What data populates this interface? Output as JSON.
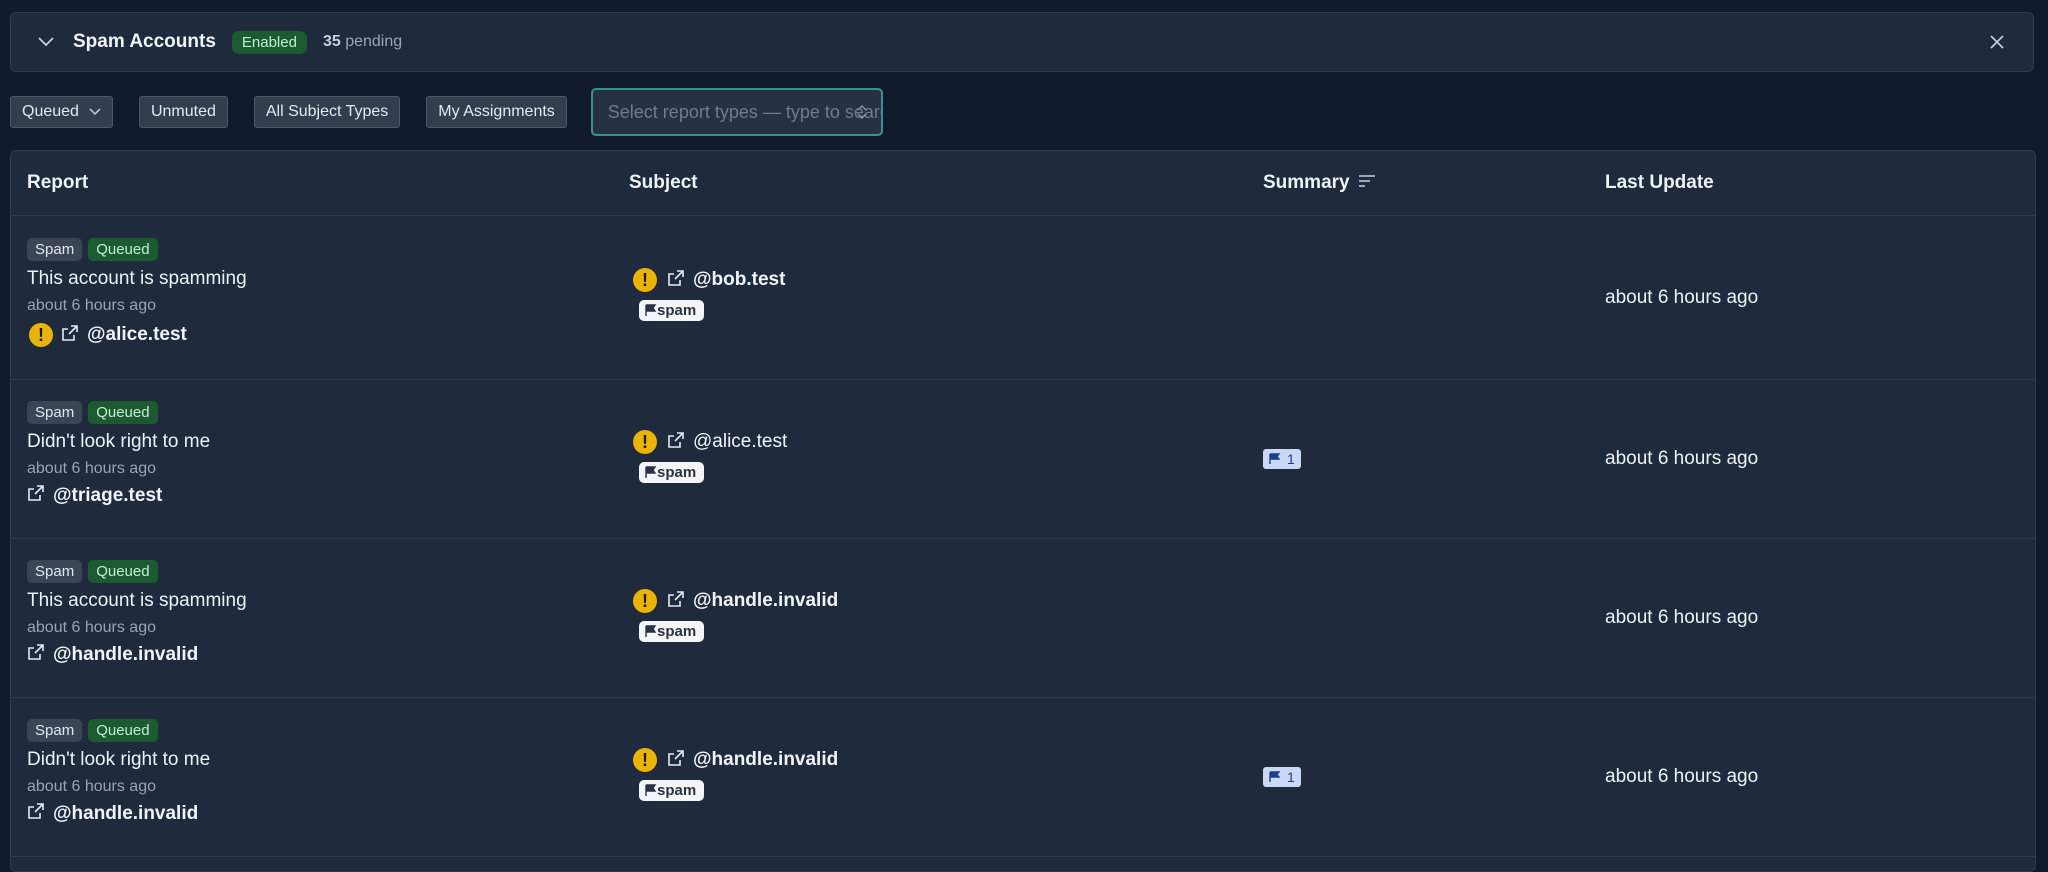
{
  "queue": {
    "name": "Spam Accounts",
    "status": "Enabled",
    "pending_count": "35",
    "pending_label": "pending"
  },
  "filters": {
    "queued": "Queued",
    "unmuted": "Unmuted",
    "subject_types": "All Subject Types",
    "assignments": "My Assignments",
    "report_type_placeholder": "Select report types — type to search"
  },
  "table": {
    "headers": {
      "report": "Report",
      "subject": "Subject",
      "summary": "Summary",
      "last_update": "Last Update"
    },
    "rows": [
      {
        "report_tag": "Spam",
        "status_tag": "Queued",
        "reason": "This account is spamming",
        "reported_ago": "about 6 hours ago",
        "reporter": "@alice.test",
        "reporter_warning": "!",
        "subject": "@bob.test",
        "subject_warning": "!",
        "subject_label": "spam",
        "summary_count": "",
        "last_update": "about 6 hours ago"
      },
      {
        "report_tag": "Spam",
        "status_tag": "Queued",
        "reason": "Didn't look right to me",
        "reported_ago": "about 6 hours ago",
        "reporter": "@triage.test",
        "reporter_warning": "",
        "subject": "@alice.test",
        "subject_warning": "!",
        "subject_label": "spam",
        "summary_count": "1",
        "last_update": "about 6 hours ago"
      },
      {
        "report_tag": "Spam",
        "status_tag": "Queued",
        "reason": "This account is spamming",
        "reported_ago": "about 6 hours ago",
        "reporter": "@handle.invalid",
        "reporter_warning": "",
        "subject": "@handle.invalid",
        "subject_warning": "!",
        "subject_label": "spam",
        "summary_count": "",
        "last_update": "about 6 hours ago"
      },
      {
        "report_tag": "Spam",
        "status_tag": "Queued",
        "reason": "Didn't look right to me",
        "reported_ago": "about 6 hours ago",
        "reporter": "@handle.invalid",
        "reporter_warning": "",
        "subject": "@handle.invalid",
        "subject_warning": "!",
        "subject_label": "spam",
        "summary_count": "1",
        "last_update": "about 6 hours ago"
      }
    ]
  }
}
